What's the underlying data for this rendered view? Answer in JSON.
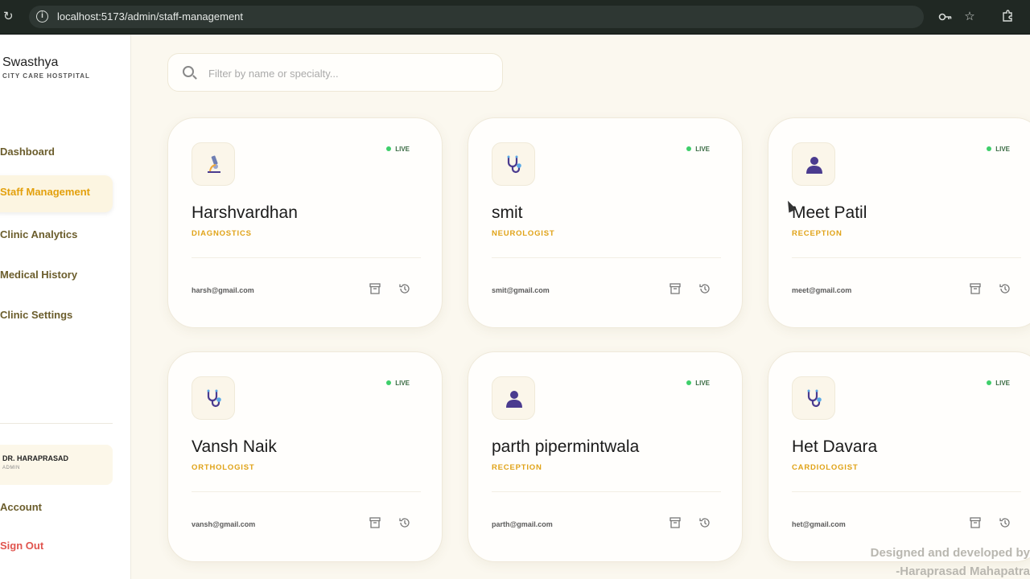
{
  "browser": {
    "url": "localhost:5173/admin/staff-management"
  },
  "sidebar": {
    "brand": "Swasthya",
    "brand_sub": "CITY CARE HOSTPITAL",
    "nav": [
      {
        "label": "Dashboard"
      },
      {
        "label": "Staff Management",
        "active": true
      },
      {
        "label": "Clinic Analytics"
      },
      {
        "label": "Medical History"
      },
      {
        "label": "Clinic Settings"
      }
    ],
    "user": {
      "name": "DR. HARAPRASAD",
      "role": "ADMIN"
    },
    "account_label": "Account",
    "signout_label": "Sign Out"
  },
  "search": {
    "placeholder": "Filter by name or specialty..."
  },
  "status_label": "LIVE",
  "colors": {
    "accent": "#e3a00d",
    "live": "#3ecf6a",
    "signout": "#e0544e",
    "icon_purple": "#4a3b8f"
  },
  "staff": [
    {
      "name": "Harshvardhan",
      "role": "DIAGNOSTICS",
      "email": "harsh@gmail.com",
      "icon": "microscope-icon"
    },
    {
      "name": "smit",
      "role": "NEUROLOGIST",
      "email": "smit@gmail.com",
      "icon": "stethoscope-icon"
    },
    {
      "name": "Meet Patil",
      "role": "RECEPTION",
      "email": "meet@gmail.com",
      "icon": "person-icon"
    },
    {
      "name": "Vansh Naik",
      "role": "ORTHOLOGIST",
      "email": "vansh@gmail.com",
      "icon": "stethoscope-icon"
    },
    {
      "name": "parth pipermintwala",
      "role": "RECEPTION",
      "email": "parth@gmail.com",
      "icon": "person-icon"
    },
    {
      "name": "Het Davara",
      "role": "CARDIOLOGIST",
      "email": "het@gmail.com",
      "icon": "stethoscope-icon"
    }
  ],
  "footer": {
    "line1": "Designed and developed by",
    "line2": "-Haraprasad Mahapatra"
  }
}
